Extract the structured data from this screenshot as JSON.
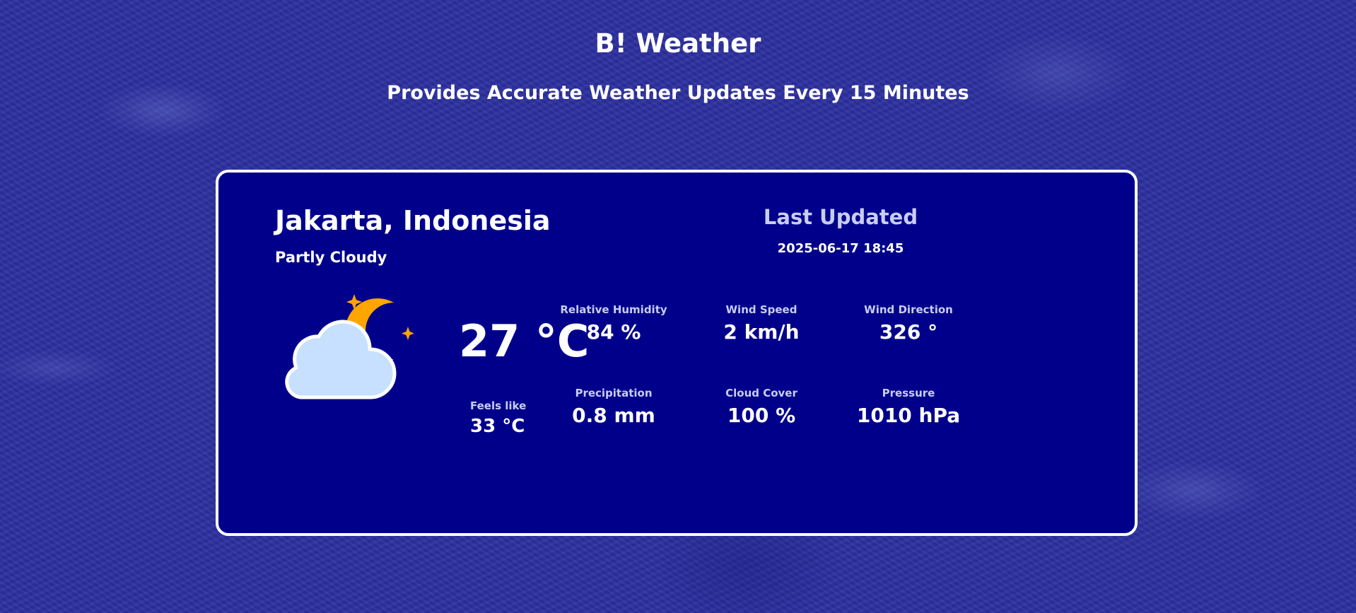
{
  "header": {
    "title": "B! Weather",
    "subtitle": "Provides Accurate Weather Updates Every 15 Minutes"
  },
  "current": {
    "location": "Jakarta, Indonesia",
    "condition": "Partly Cloudy",
    "icon": "partly-cloudy-night-icon",
    "temperature": "27 °C",
    "feels_like_label": "Feels like",
    "feels_like_value": "33 °C"
  },
  "updated": {
    "title": "Last Updated",
    "timestamp": "2025-06-17 18:45"
  },
  "stats": [
    {
      "label": "Relative Humidity",
      "value": "84 %"
    },
    {
      "label": "Wind Speed",
      "value": "2 km/h"
    },
    {
      "label": "Wind Direction",
      "value": "326 °"
    },
    {
      "label": "Precipitation",
      "value": "0.8 mm"
    },
    {
      "label": "Cloud Cover",
      "value": "100 %"
    },
    {
      "label": "Pressure",
      "value": "1010 hPa"
    }
  ],
  "colors": {
    "card_background": "#00008b",
    "moon": "#ffa500",
    "cloud": "#c8e0ff",
    "muted_text": "#c9cdf2"
  }
}
